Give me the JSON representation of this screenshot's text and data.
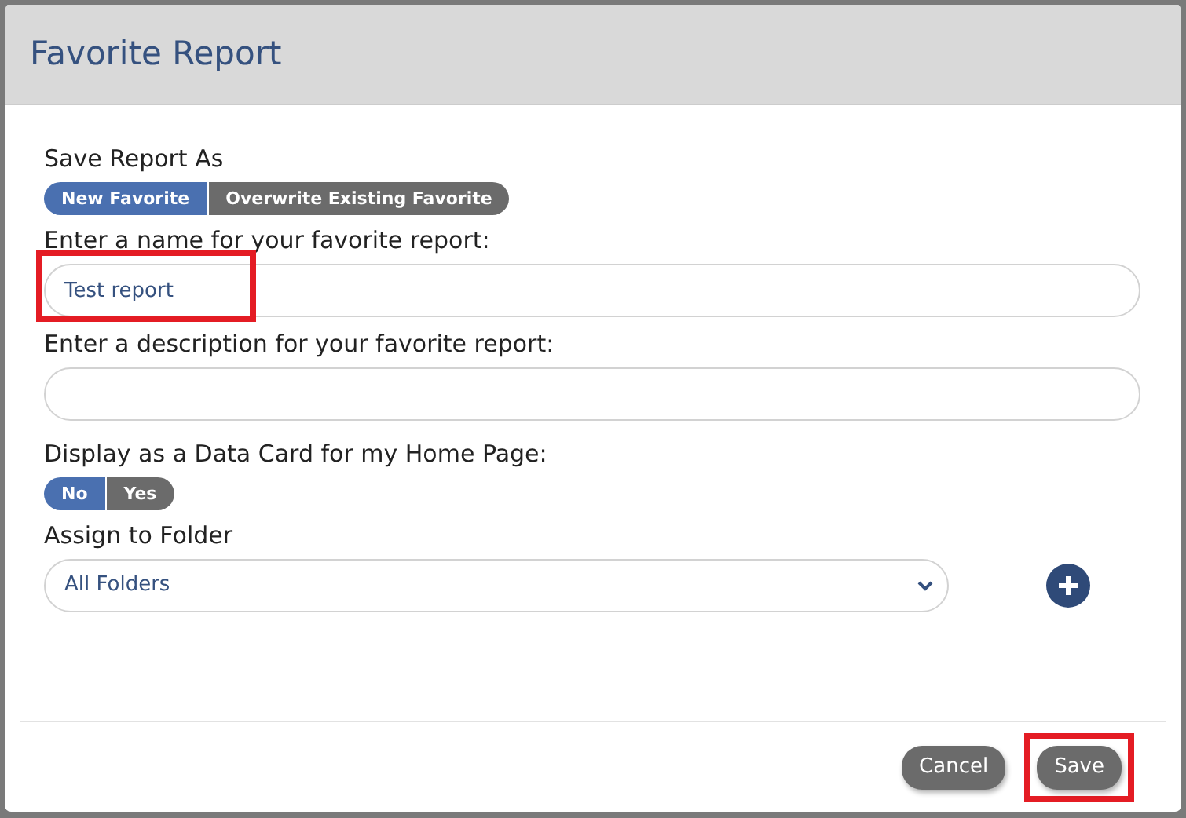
{
  "dialog": {
    "title": "Favorite Report"
  },
  "save_as": {
    "label": "Save Report As",
    "options": [
      {
        "label": "New Favorite",
        "selected": true
      },
      {
        "label": "Overwrite Existing Favorite",
        "selected": false
      }
    ]
  },
  "name_field": {
    "label": "Enter a name for your favorite report:",
    "value": "Test report",
    "highlighted": true
  },
  "description_field": {
    "label": "Enter a description for your favorite report:"
  },
  "data_card": {
    "label": "Display as a Data Card for my Home Page:",
    "options": [
      {
        "label": "No",
        "selected": true
      },
      {
        "label": "Yes",
        "selected": false
      }
    ]
  },
  "folder": {
    "label": "Assign to Folder",
    "value": "All Folders"
  },
  "buttons": [
    {
      "label": "Cancel",
      "highlighted": false
    },
    {
      "label": "Save",
      "highlighted": true
    }
  ]
}
